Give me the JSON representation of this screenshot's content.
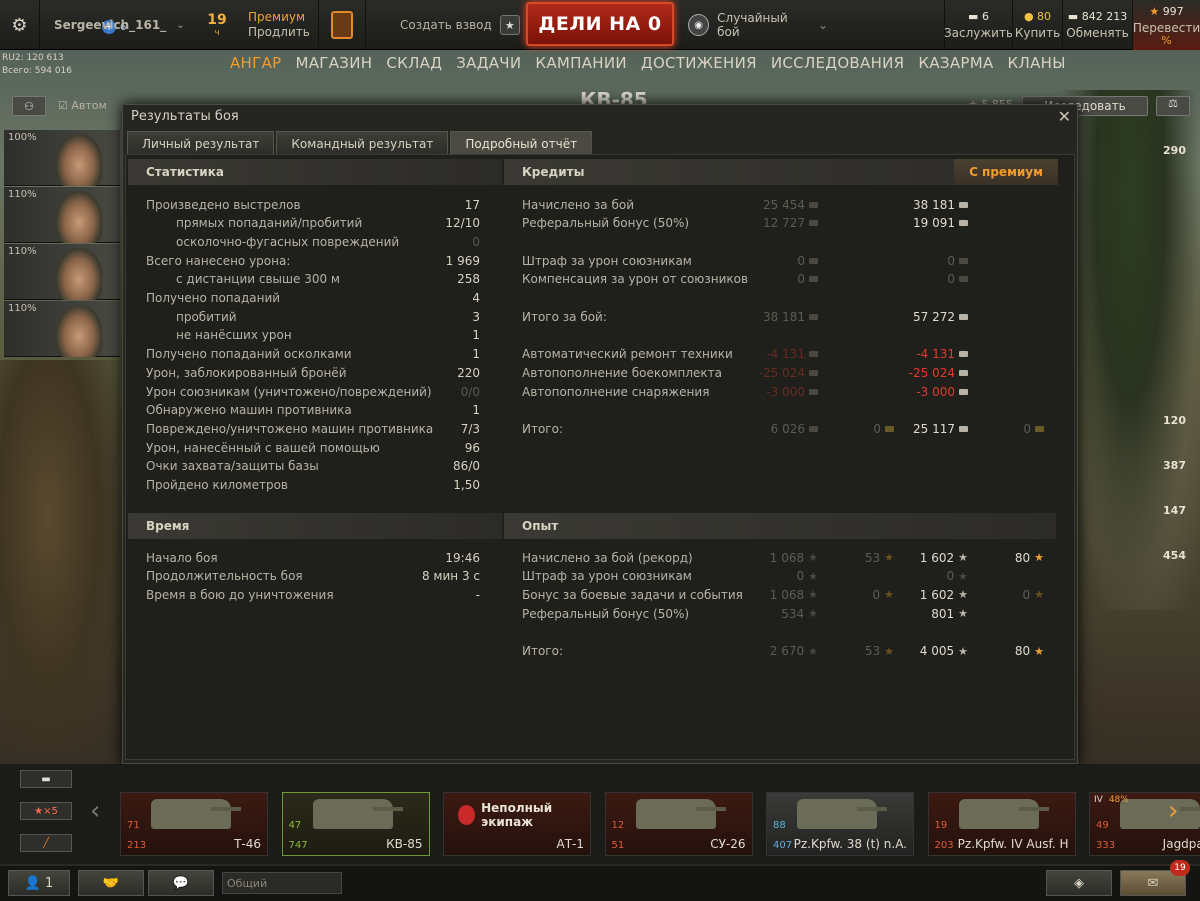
{
  "topbar": {
    "username": "Sergeevich_161_",
    "clan_count": "6",
    "premium_days": "19",
    "premium_unit": "ч",
    "premium_label": "Премиум",
    "premium_extend": "Продлить",
    "platoon": "Создать взвод",
    "battle_button": "ДЕЛИ НА 0",
    "battle_mode": "Случайный бой",
    "resources": [
      {
        "value": "6",
        "label": "Заслужить"
      },
      {
        "value": "80",
        "label": "Купить"
      },
      {
        "value": "842 213",
        "label": "Обменять"
      },
      {
        "value": "997",
        "label": "Перевести"
      }
    ],
    "exchange_pct": "%"
  },
  "rating": {
    "line1": "RU2: 120 613",
    "line2": "Всего: 594 016"
  },
  "nav": [
    "АНГАР",
    "МАГАЗИН",
    "СКЛАД",
    "ЗАДАЧИ",
    "КАМПАНИИ",
    "ДОСТИЖЕНИЯ",
    "ИССЛЕДОВАНИЯ",
    "КАЗАРМА",
    "КЛАНЫ"
  ],
  "hangar": {
    "tank_name": "КВ-85",
    "research": "Исследовать",
    "auto_label": "Автом",
    "xp_num": "5 855"
  },
  "crew": [
    "100%",
    "110%",
    "110%",
    "110%"
  ],
  "right_nums": [
    "290",
    "120",
    "387",
    "147",
    "454"
  ],
  "dialog": {
    "title": "Результаты боя",
    "tabs": [
      "Личный результат",
      "Командный результат",
      "Подробный отчёт"
    ],
    "stats_header": "Статистика",
    "credits_header": "Кредиты",
    "premium_header": "С премиум",
    "time_header": "Время",
    "xp_header": "Опыт"
  },
  "stats": [
    {
      "label": "Произведено выстрелов",
      "value": "17",
      "dim": false,
      "indent": false
    },
    {
      "label": "прямых попаданий/пробитий",
      "value": "12/10",
      "dim": false,
      "indent": true
    },
    {
      "label": "осколочно-фугасных повреждений",
      "value": "0",
      "dim": true,
      "indent": true
    },
    {
      "label": "Всего нанесено урона:",
      "value": "1 969",
      "dim": false,
      "indent": false
    },
    {
      "label": "с дистанции свыше 300 м",
      "value": "258",
      "dim": false,
      "indent": true
    },
    {
      "label": "Получено попаданий",
      "value": "4",
      "dim": false,
      "indent": false
    },
    {
      "label": "пробитий",
      "value": "3",
      "dim": false,
      "indent": true
    },
    {
      "label": "не нанёсших урон",
      "value": "1",
      "dim": false,
      "indent": true
    },
    {
      "label": "Получено попаданий осколками",
      "value": "1",
      "dim": false,
      "indent": false
    },
    {
      "label": "Урон, заблокированный бронёй",
      "value": "220",
      "dim": false,
      "indent": false
    },
    {
      "label": "Урон союзникам (уничтожено/повреждений)",
      "value": "0/0",
      "dim": true,
      "indent": false
    },
    {
      "label": "Обнаружено машин противника",
      "value": "1",
      "dim": false,
      "indent": false
    },
    {
      "label": "Повреждено/уничтожено машин противника",
      "value": "7/3",
      "dim": false,
      "indent": false
    },
    {
      "label": "Урон, нанесённый с вашей помощью",
      "value": "96",
      "dim": false,
      "indent": false
    },
    {
      "label": "Очки захвата/защиты базы",
      "value": "86/0",
      "dim": false,
      "indent": false
    },
    {
      "label": "Пройдено километров",
      "value": "1,50",
      "dim": false,
      "indent": false
    }
  ],
  "credits": [
    {
      "label": "Начислено за бой",
      "base": "25 454",
      "prem": "38 181",
      "red": false,
      "y": 0
    },
    {
      "label": "Реферальный бонус (50%)",
      "base": "12 727",
      "prem": "19 091",
      "red": false,
      "y": 1
    },
    {
      "label": "Штраф за урон союзникам",
      "base": "0",
      "prem": "0",
      "red": false,
      "dimprem": true,
      "y": 3
    },
    {
      "label": "Компенсация за урон от союзников",
      "base": "0",
      "prem": "0",
      "red": false,
      "dimprem": true,
      "y": 4
    },
    {
      "label": "Итого за бой:",
      "base": "38 181",
      "prem": "57 272",
      "red": false,
      "y": 6
    },
    {
      "label": "Автоматический ремонт техники",
      "base": "-4 131",
      "prem": "-4 131",
      "red": true,
      "y": 8
    },
    {
      "label": "Автопополнение боекомплекта",
      "base": "-25 024",
      "prem": "-25 024",
      "red": true,
      "y": 9
    },
    {
      "label": "Автопополнение снаряжения",
      "base": "-3 000",
      "prem": "-3 000",
      "red": true,
      "y": 10
    }
  ],
  "credits_total": {
    "label": "Итого:",
    "base": "6 026",
    "base_gold": "0",
    "prem": "25 117",
    "prem_gold": "0"
  },
  "time": [
    {
      "label": "Начало боя",
      "value": "19:46"
    },
    {
      "label": "Продолжительность боя",
      "value": "8 мин 3 с"
    },
    {
      "label": "Время в бою до уничтожения",
      "value": "-"
    }
  ],
  "xp": [
    {
      "label": "Начислено за бой (рекорд)",
      "base": "1 068",
      "base_free": "53",
      "prem": "1 602",
      "prem_free": "80",
      "y": 0,
      "dimprem": false,
      "dimfree": false
    },
    {
      "label": "Штраф за урон союзникам",
      "base": "0",
      "base_free": "",
      "prem": "0",
      "prem_free": "",
      "y": 1,
      "dimprem": true,
      "dimfree": true
    },
    {
      "label": "Бонус за боевые задачи и события",
      "base": "1 068",
      "base_free": "0",
      "prem": "1 602",
      "prem_free": "0",
      "y": 2,
      "dimprem": false,
      "dimfree": true
    },
    {
      "label": "Реферальный бонус (50%)",
      "base": "534",
      "base_free": "",
      "prem": "801",
      "prem_free": "",
      "y": 3,
      "dimprem": false,
      "dimfree": true
    },
    {
      "label": "Итого:",
      "base": "2 670",
      "base_free": "53",
      "prem": "4 005",
      "prem_free": "80",
      "y": 5,
      "dimprem": false,
      "dimfree": false
    }
  ],
  "left_tools": {
    "stars": "★×5"
  },
  "carousel": [
    {
      "name": "Т-46",
      "a": "71",
      "b": "213",
      "style": "red"
    },
    {
      "name": "КВ-85",
      "a": "47",
      "b": "747",
      "style": "sel"
    },
    {
      "name": "АТ-1",
      "a": "",
      "b": "",
      "style": "warn",
      "warn": "Неполный экипаж"
    },
    {
      "name": "СУ-26",
      "a": "12",
      "b": "51",
      "style": "red"
    },
    {
      "name": "Pz.Kpfw. 38 (t) n.A.",
      "a": "88",
      "b": "407",
      "style": "gray"
    },
    {
      "name": "Pz.Kpfw. IV Ausf. H",
      "a": "19",
      "b": "203",
      "style": "red"
    },
    {
      "name": "Jagdpanzer",
      "a": "49",
      "b": "333",
      "style": "red",
      "badge": "IV",
      "pct": "48%"
    }
  ],
  "bottombar": {
    "players": "1",
    "chat_placeholder": "Общий",
    "notif": "19"
  }
}
